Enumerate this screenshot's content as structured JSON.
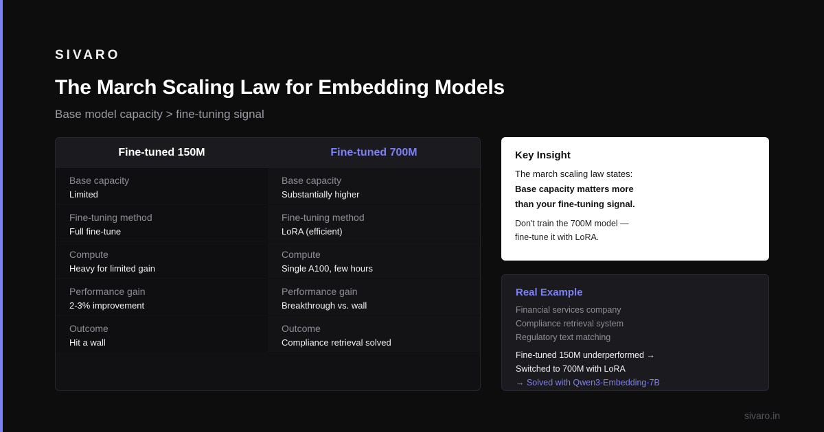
{
  "brand": "SIVARO",
  "title": "The March Scaling Law for Embedding Models",
  "subtitle": "Base model capacity > fine-tuning signal",
  "compare": {
    "left": {
      "header": "Fine-tuned 150M",
      "rows": [
        {
          "label": "Base capacity",
          "value": "Limited"
        },
        {
          "label": "Fine-tuning method",
          "value": "Full fine-tune"
        },
        {
          "label": "Compute",
          "value": "Heavy for limited gain"
        },
        {
          "label": "Performance gain",
          "value": "2-3% improvement"
        },
        {
          "label": "Outcome",
          "value": "Hit a wall"
        }
      ]
    },
    "right": {
      "header": "Fine-tuned 700M",
      "rows": [
        {
          "label": "Base capacity",
          "value": "Substantially higher"
        },
        {
          "label": "Fine-tuning method",
          "value": "LoRA (efficient)"
        },
        {
          "label": "Compute",
          "value": "Single A100, few hours"
        },
        {
          "label": "Performance gain",
          "value": "Breakthrough vs. wall"
        },
        {
          "label": "Outcome",
          "value": "Compliance retrieval solved"
        }
      ]
    }
  },
  "insight": {
    "title": "Key Insight",
    "line1": "The march scaling law states:",
    "line2": "Base capacity matters more",
    "line3": "than your fine-tuning signal.",
    "note1": "Don't train the 700M model —",
    "note2": "fine-tune it with LoRA."
  },
  "example": {
    "title": "Real Example",
    "muted": [
      "Financial services company",
      "Compliance retrieval system",
      "Regulatory text matching"
    ],
    "line1": "Fine-tuned 150M underperformed →",
    "line2": "Switched to 700M with LoRA",
    "link": "→ Solved with Qwen3-Embedding-7B"
  },
  "footer": "sivaro.in",
  "colors": {
    "accent": "#7b80f5",
    "background": "#0d0d0e",
    "card_white": "#ffffff"
  }
}
